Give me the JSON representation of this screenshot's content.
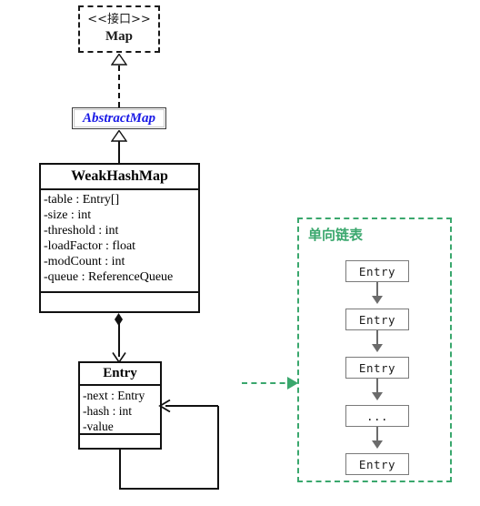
{
  "diagram": {
    "title": "WeakHashMap UML class diagram",
    "colors": {
      "line": "#111111",
      "interface_text": "#1a1a1a",
      "abstract_class_text": "#1919e6",
      "panel_accent": "#3aa76d",
      "node_border": "#7a7a7a",
      "node_arrow": "#6b6b6b"
    }
  },
  "interface": {
    "stereotype": "<<接口>>",
    "name": "Map"
  },
  "abstract_class": {
    "name": "AbstractMap"
  },
  "weak_hash_map": {
    "name": "WeakHashMap",
    "attributes": [
      "-table : Entry[]",
      "-size : int",
      "-threshold : int",
      "-loadFactor : float",
      "-modCount : int",
      "-queue : ReferenceQueue"
    ],
    "methods": []
  },
  "entry_class": {
    "name": "Entry",
    "attributes": [
      "-next : Entry",
      "-hash : int",
      "-value"
    ],
    "methods": []
  },
  "linked_list_panel": {
    "title": "单向链表",
    "nodes": [
      {
        "label": "Entry"
      },
      {
        "label": "Entry"
      },
      {
        "label": "Entry"
      },
      {
        "label": "..."
      },
      {
        "label": "Entry"
      }
    ]
  },
  "relations": {
    "realization_label": "Map <|.. AbstractMap",
    "generalization_label": "AbstractMap <|-- WeakHashMap",
    "composition_label": "WeakHashMap *-- Entry",
    "self_association_label": "Entry -> Entry",
    "note_link_label": "Entry ..> 单向链表"
  }
}
